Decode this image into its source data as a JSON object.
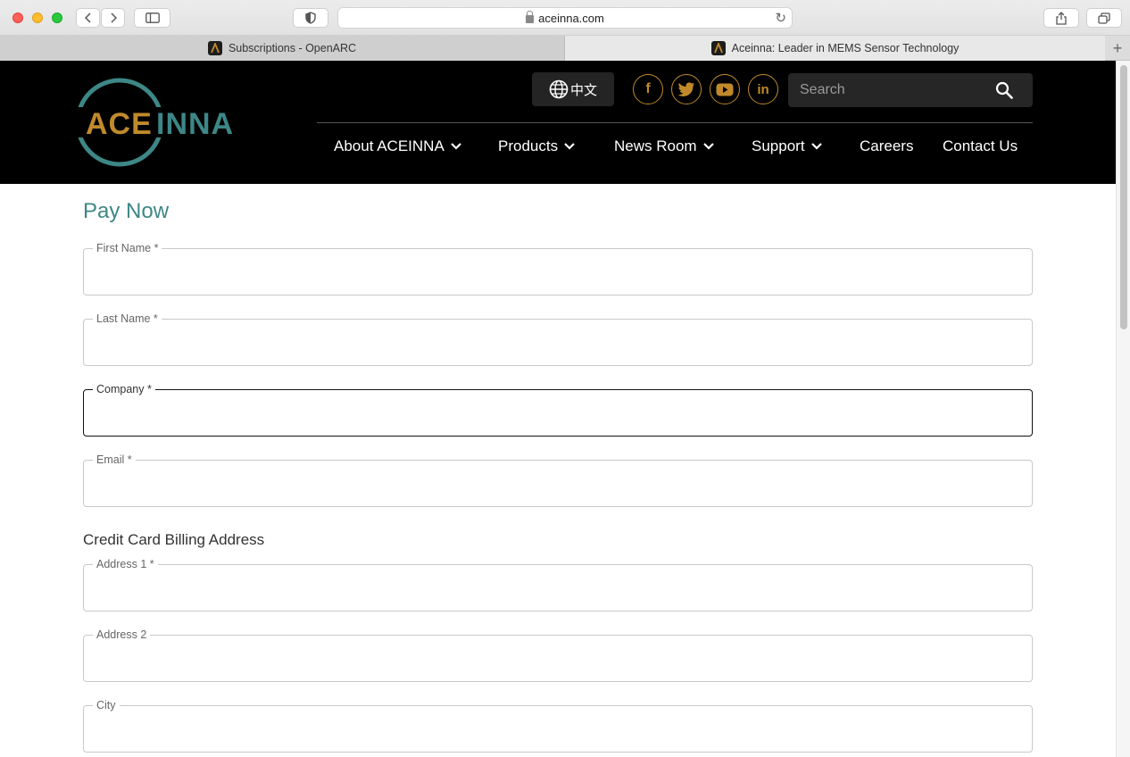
{
  "browser": {
    "url": "aceinna.com",
    "tabs": [
      {
        "label": "Subscriptions - OpenARC"
      },
      {
        "label": "Aceinna: Leader in MEMS Sensor Technology"
      }
    ]
  },
  "header": {
    "logo_text": "ACEINNA",
    "language_label": "中文",
    "social": [
      {
        "name": "facebook",
        "glyph": "f"
      },
      {
        "name": "twitter",
        "glyph": "t"
      },
      {
        "name": "youtube",
        "glyph": "▶"
      },
      {
        "name": "linkedin",
        "glyph": "in"
      }
    ],
    "search_placeholder": "Search",
    "nav": [
      {
        "label": "About ACEINNA",
        "dropdown": true
      },
      {
        "label": "Products",
        "dropdown": true
      },
      {
        "label": "News Room",
        "dropdown": true
      },
      {
        "label": "Support",
        "dropdown": true
      },
      {
        "label": "Careers",
        "dropdown": false
      },
      {
        "label": "Contact Us",
        "dropdown": false
      }
    ]
  },
  "form": {
    "title": "Pay Now",
    "fields": [
      {
        "label": "First Name *",
        "value": ""
      },
      {
        "label": "Last Name *",
        "value": ""
      },
      {
        "label": "Company *",
        "value": "",
        "focused": true
      },
      {
        "label": "Email *",
        "value": ""
      }
    ],
    "billing_heading": "Credit Card Billing Address",
    "billing_fields": [
      {
        "label": "Address 1 *",
        "value": ""
      },
      {
        "label": "Address 2",
        "value": ""
      },
      {
        "label": "City",
        "value": ""
      }
    ]
  },
  "colors": {
    "accent": "#3d8786",
    "gold": "#c08a2b",
    "header_bg": "#000000"
  }
}
